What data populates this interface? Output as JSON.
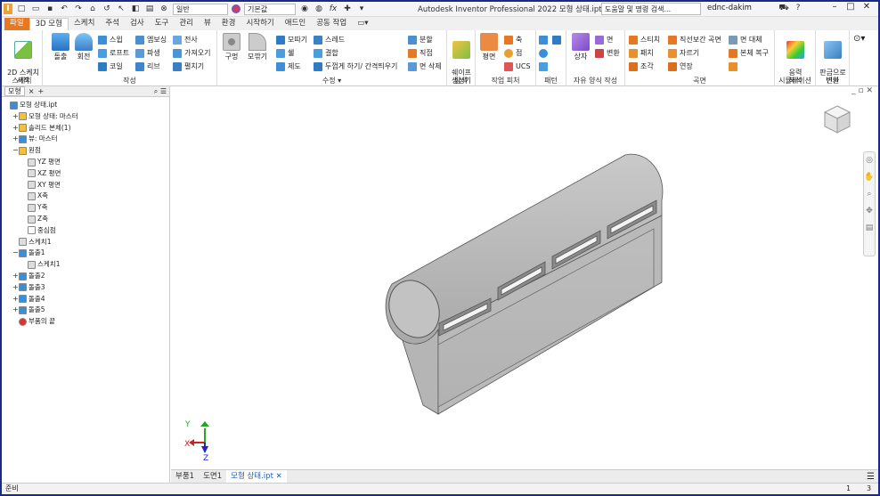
{
  "titlebar": {
    "workspace_dropdown": "일반",
    "appearance_dropdown": "기본값",
    "title": "Autodesk Inventor Professional 2022   모형 상태.ipt",
    "search_placeholder": "도움말 및 명령 검색...",
    "user": "ednc-dakim"
  },
  "tabs": [
    "파일",
    "3D 모형",
    "스케치",
    "주석",
    "검사",
    "도구",
    "관리",
    "뷰",
    "환경",
    "시작하기",
    "애드인",
    "공동 작업"
  ],
  "ribbon": {
    "sketch": {
      "label": "스케치",
      "new_sketch": "2D 스케치\n시작"
    },
    "create": {
      "label": "작성",
      "extrude": "돌출",
      "revolve": "회전",
      "sweep": "스윕",
      "loft": "로프트",
      "coil": "코일",
      "emboss": "엠보싱",
      "derive": "파생",
      "rib": "리브",
      "decal": "전사",
      "import": "가져오기",
      "unwrap": "펼치기"
    },
    "modify": {
      "label": "수정",
      "hole": "구멍",
      "fillet": "모깎기",
      "chamfer": "모따기",
      "shell": "쉘",
      "draft": "제도",
      "thread": "스레드",
      "combine": "결합",
      "thicken": "두껍게 하기/ 간격띄우기",
      "split": "분할",
      "direct": "직접",
      "delete_face": "면 삭제"
    },
    "explore": {
      "label": "탐색",
      "shape_gen": "쉐이프\n생성기"
    },
    "work": {
      "label": "작업 피처",
      "plane": "평면",
      "axis": "축",
      "point": "점",
      "ucs": "UCS"
    },
    "pattern": {
      "label": "패턴"
    },
    "freeform": {
      "label": "자유 양식 작성",
      "box": "상자",
      "face": "면",
      "convert": "변환"
    },
    "surface": {
      "label": "곡면",
      "stitch": "스티치",
      "patch": "패치",
      "sculpt": "조각",
      "ruled": "직선보간 곡면",
      "trim": "자르기",
      "extend": "연장",
      "replace_face": "면 대체",
      "repair": "본체 복구"
    },
    "simulation": {
      "label": "시뮬레이션",
      "stress": "응력\n해석"
    },
    "convert": {
      "label": "변환",
      "sheetmetal": "판금으로\n변환"
    }
  },
  "browser": {
    "tab": "모형",
    "nodes": [
      {
        "label": "모형 상태.ipt",
        "exp": ""
      },
      {
        "label": "모형 상태: 마스터",
        "exp": "+"
      },
      {
        "label": "솔리드 본체(1)",
        "exp": "+"
      },
      {
        "label": "뷰: 마스터",
        "exp": "+"
      },
      {
        "label": "원점",
        "exp": "−"
      },
      {
        "label": "YZ 평면",
        "exp": ""
      },
      {
        "label": "XZ 평면",
        "exp": ""
      },
      {
        "label": "XY 평면",
        "exp": ""
      },
      {
        "label": "X축",
        "exp": ""
      },
      {
        "label": "Y축",
        "exp": ""
      },
      {
        "label": "Z축",
        "exp": ""
      },
      {
        "label": "중심점",
        "exp": ""
      },
      {
        "label": "스케치1",
        "exp": ""
      },
      {
        "label": "돌출1",
        "exp": "−"
      },
      {
        "label": "스케치1",
        "exp": ""
      },
      {
        "label": "돌출2",
        "exp": "+"
      },
      {
        "label": "돌출3",
        "exp": "+"
      },
      {
        "label": "돌출4",
        "exp": "+"
      },
      {
        "label": "돌출5",
        "exp": "+"
      },
      {
        "label": "부품의 끝",
        "exp": ""
      }
    ]
  },
  "doc_tabs": [
    "부품1",
    "도면1",
    "모형 상태.ipt"
  ],
  "status": {
    "left": "준비",
    "count1": "1",
    "count2": "3"
  },
  "axis_labels": {
    "x": "X",
    "y": "Y",
    "z": "Z"
  },
  "colors": {
    "file_tab": "#e87722",
    "active_doc": "#1a5fb4",
    "frame": "#1a2a8a"
  }
}
